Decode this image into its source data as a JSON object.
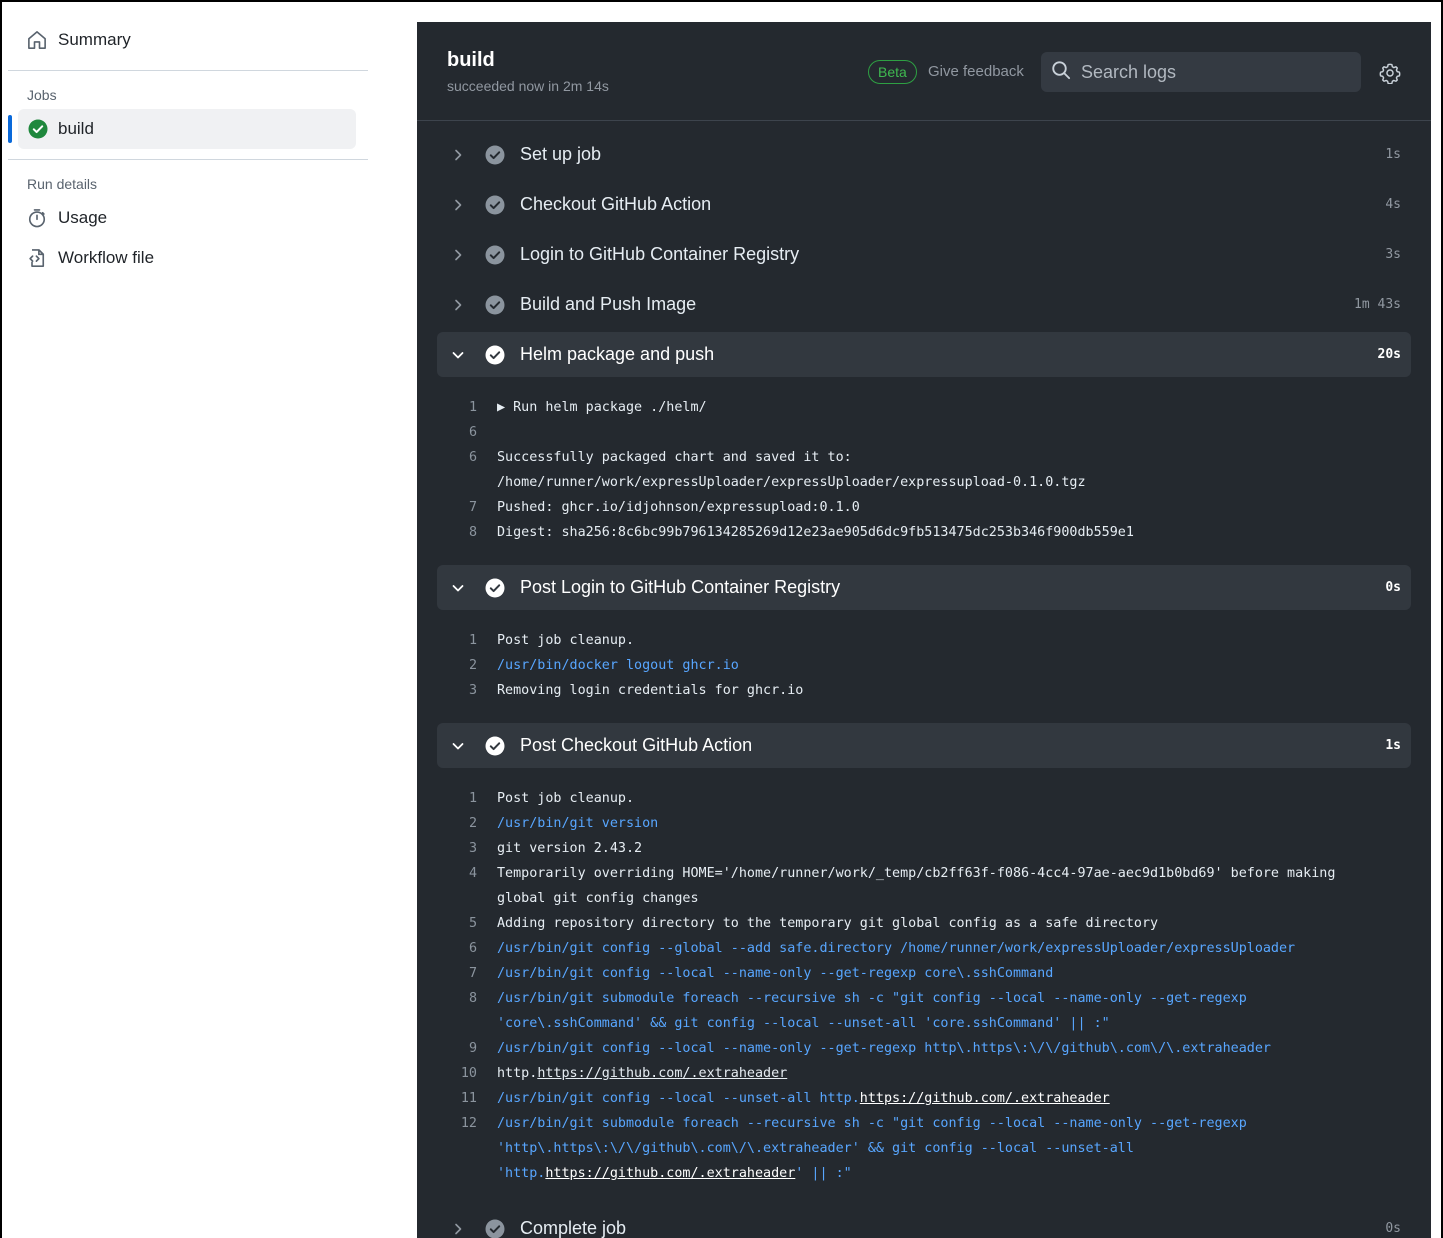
{
  "sidebar": {
    "summary": "Summary",
    "jobs_heading": "Jobs",
    "job": "build",
    "run_details_heading": "Run details",
    "usage": "Usage",
    "workflow_file": "Workflow file"
  },
  "header": {
    "title": "build",
    "subtitle": "succeeded now in 2m 14s",
    "beta": "Beta",
    "feedback": "Give feedback",
    "search_placeholder": "Search logs"
  },
  "steps": [
    {
      "name": "Set up job",
      "duration": "1s"
    },
    {
      "name": "Checkout GitHub Action",
      "duration": "4s"
    },
    {
      "name": "Login to GitHub Container Registry",
      "duration": "3s"
    },
    {
      "name": "Build and Push Image",
      "duration": "1m 43s"
    },
    {
      "name": "Helm package and push",
      "duration": "20s",
      "lines": [
        {
          "n": "1",
          "text": "▶ Run helm package ./helm/"
        },
        {
          "n": "6",
          "text": ""
        },
        {
          "n": "6",
          "text": "Successfully packaged chart and saved it to:"
        },
        {
          "n": "",
          "text": "/home/runner/work/expressUploader/expressUploader/expressupload-0.1.0.tgz"
        },
        {
          "n": "7",
          "text": "Pushed: ghcr.io/idjohnson/expressupload:0.1.0"
        },
        {
          "n": "8",
          "text": "Digest: sha256:8c6bc99b796134285269d12e23ae905d6dc9fb513475dc253b346f900db559e1"
        }
      ]
    },
    {
      "name": "Post Login to GitHub Container Registry",
      "duration": "0s",
      "lines": [
        {
          "n": "1",
          "text": "Post job cleanup."
        },
        {
          "n": "2",
          "text": "/usr/bin/docker logout ghcr.io"
        },
        {
          "n": "3",
          "text": "Removing login credentials for ghcr.io"
        }
      ]
    },
    {
      "name": "Post Checkout GitHub Action",
      "duration": "1s",
      "lines": [
        {
          "n": "1",
          "text": "Post job cleanup."
        },
        {
          "n": "2",
          "text": "/usr/bin/git version"
        },
        {
          "n": "3",
          "text": "git version 2.43.2"
        },
        {
          "n": "4",
          "text": "Temporarily overriding HOME='/home/runner/work/_temp/cb2ff63f-f086-4cc4-97ae-aec9d1b0bd69' before making"
        },
        {
          "n": "",
          "text": "global git config changes"
        },
        {
          "n": "5",
          "text": "Adding repository directory to the temporary git global config as a safe directory"
        },
        {
          "n": "6",
          "text": "/usr/bin/git config --global --add safe.directory /home/runner/work/expressUploader/expressUploader"
        },
        {
          "n": "7",
          "text": "/usr/bin/git config --local --name-only --get-regexp core\\.sshCommand"
        },
        {
          "n": "8",
          "text": "/usr/bin/git submodule foreach --recursive sh -c \"git config --local --name-only --get-regexp"
        },
        {
          "n": "",
          "text": "'core\\.sshCommand' && git config --local --unset-all 'core.sshCommand' || :\""
        },
        {
          "n": "9",
          "text": "/usr/bin/git config --local --name-only --get-regexp http\\.https\\:\\/\\/github\\.com\\/\\.extraheader"
        },
        {
          "n": "10",
          "text": "http.https://github.com/.extraheader"
        },
        {
          "n": "11",
          "text": "/usr/bin/git config --local --unset-all http.https://github.com/.extraheader"
        },
        {
          "n": "12",
          "text": "/usr/bin/git submodule foreach --recursive sh -c \"git config --local --name-only --get-regexp"
        },
        {
          "n": "",
          "text": "'http\\.https\\:\\/\\/github\\.com\\/\\.extraheader' && git config --local --unset-all"
        },
        {
          "n": "",
          "text": "'http.https://github.com/.extraheader' || :\""
        }
      ]
    },
    {
      "name": "Complete job",
      "duration": "0s"
    }
  ],
  "colors": {
    "panel_bg": "#24292f",
    "command_blue": "#58a6ff",
    "success_green": "#1f883d",
    "accent_blue": "#0969da"
  },
  "icons": {
    "summary": "home-icon",
    "job_status": "check-circle-fill-icon",
    "usage": "stopwatch-icon",
    "workflow": "file-code-icon",
    "search": "search-icon",
    "settings": "gear-icon"
  }
}
